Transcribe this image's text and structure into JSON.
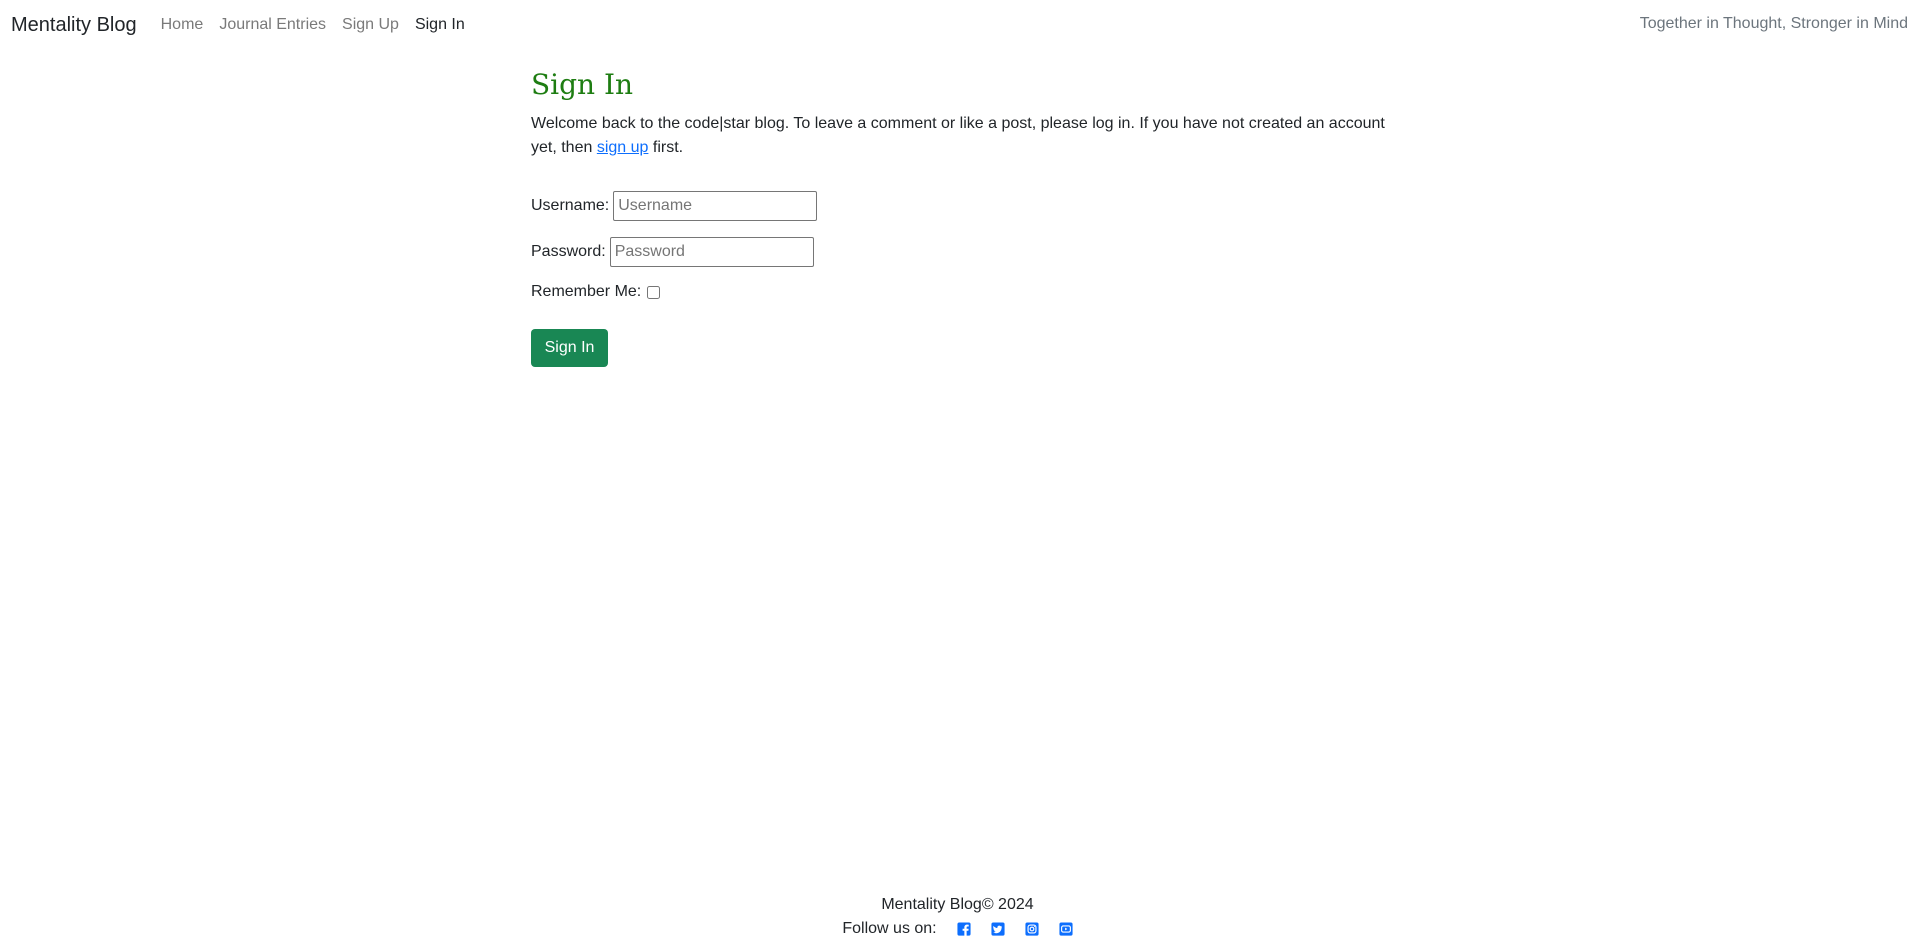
{
  "nav": {
    "brand": "Mentality Blog",
    "links": [
      "Home",
      "Journal Entries",
      "Sign Up",
      "Sign In"
    ],
    "tagline": "Together in Thought, Stronger in Mind"
  },
  "main": {
    "title": "Sign In",
    "intro_before": "Welcome back to the code|star blog. To leave a comment or like a post, please log in. If you have not created an account yet, then ",
    "intro_link": "sign up",
    "intro_after": " first.",
    "username_label": "Username:",
    "username_placeholder": "Username",
    "password_label": "Password:",
    "password_placeholder": "Password",
    "remember_label": "Remember Me:",
    "submit_label": "Sign In"
  },
  "footer": {
    "copyright": "Mentality Blog© 2024",
    "follow_label": "Follow us on:",
    "social_icons": [
      "facebook-icon",
      "twitter-icon",
      "instagram-icon",
      "youtube-icon"
    ],
    "icon_color": "#0d6efd"
  },
  "colors": {
    "title": "#1e7d12",
    "primary_button": "#198754",
    "link": "#0d6efd"
  }
}
